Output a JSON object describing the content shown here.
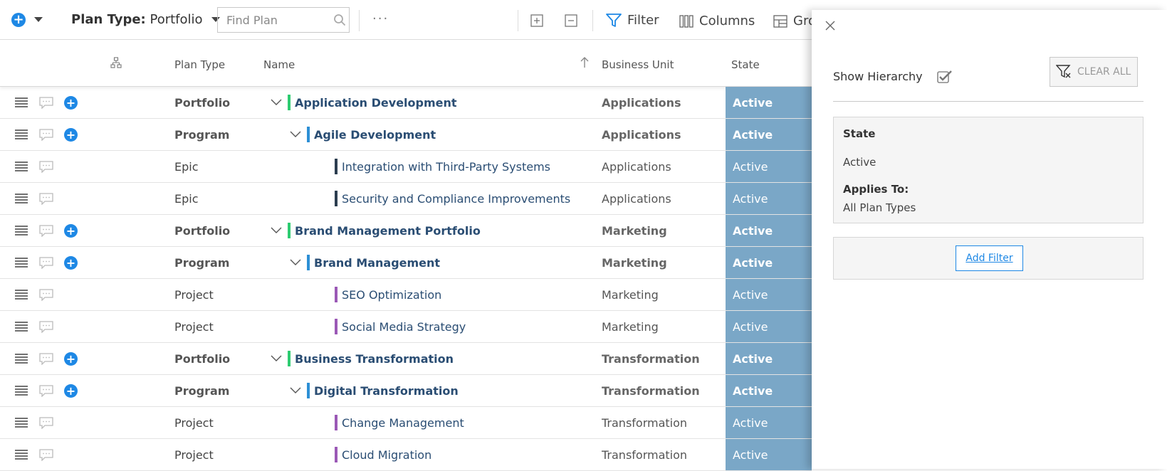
{
  "toolbar": {
    "plan_type_label": "Plan Type:",
    "plan_type_value": "Portfolio",
    "search_placeholder": "Find Plan",
    "more": "···",
    "filter_label": "Filter",
    "columns_label": "Columns",
    "group_label": "Gro"
  },
  "columns": {
    "plan_type": "Plan Type",
    "name": "Name",
    "business_unit": "Business Unit",
    "state": "State"
  },
  "rows": [
    {
      "plan_type": "Portfolio",
      "name": "Application Development",
      "business_unit": "Applications",
      "state": "Active"
    },
    {
      "plan_type": "Program",
      "name": "Agile Development",
      "business_unit": "Applications",
      "state": "Active"
    },
    {
      "plan_type": "Epic",
      "name": "Integration with Third-Party Systems",
      "business_unit": "Applications",
      "state": "Active"
    },
    {
      "plan_type": "Epic",
      "name": "Security and Compliance Improvements",
      "business_unit": "Applications",
      "state": "Active"
    },
    {
      "plan_type": "Portfolio",
      "name": "Brand Management Portfolio",
      "business_unit": "Marketing",
      "state": "Active"
    },
    {
      "plan_type": "Program",
      "name": "Brand Management",
      "business_unit": "Marketing",
      "state": "Active"
    },
    {
      "plan_type": "Project",
      "name": "SEO Optimization",
      "business_unit": "Marketing",
      "state": "Active"
    },
    {
      "plan_type": "Project",
      "name": "Social Media Strategy",
      "business_unit": "Marketing",
      "state": "Active"
    },
    {
      "plan_type": "Portfolio",
      "name": "Business Transformation",
      "business_unit": "Transformation",
      "state": "Active"
    },
    {
      "plan_type": "Program",
      "name": "Digital Transformation",
      "business_unit": "Transformation",
      "state": "Active"
    },
    {
      "plan_type": "Project",
      "name": "Change Management",
      "business_unit": "Transformation",
      "state": "Active"
    },
    {
      "plan_type": "Project",
      "name": "Cloud Migration",
      "business_unit": "Transformation",
      "state": "Active"
    }
  ],
  "panel": {
    "show_hierarchy_label": "Show Hierarchy",
    "clear_all_label": "CLEAR ALL",
    "filter_state_title": "State",
    "filter_state_value": "Active",
    "applies_to_title": "Applies To:",
    "applies_to_value": "All Plan Types",
    "add_filter_label": "Add Filter"
  },
  "colors": {
    "accent": "#1e88e5",
    "state_bg": "#7aa7c7",
    "portfolio_bar": "#2ecc71",
    "program_bar": "#2d8fd5",
    "epic_bar": "#2c3e50",
    "project_bar": "#9b59b6"
  }
}
